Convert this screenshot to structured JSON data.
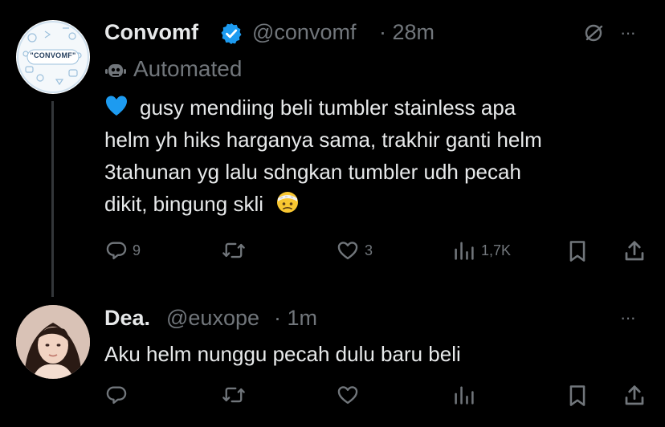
{
  "tweet1": {
    "display_name": "Convomf",
    "handle": "@convomf",
    "time": "· 28m",
    "automated_label": "Automated",
    "avatar_text": "\"CONVOMF\"",
    "lines": [
      "gusy mendiing beli tumbler stainless apa",
      "helm yh hiks harganya sama, trakhir ganti helm",
      "3tahunan yg lalu sdngkan tumbler udh pecah",
      "dikit, bingung skli"
    ],
    "replies": "9",
    "reposts": "",
    "likes": "3",
    "views": "1,7K",
    "more": "···"
  },
  "tweet2": {
    "display_name": "Dea.",
    "handle": "@euxope",
    "time": "· 1m",
    "text": "Aku helm nunggu pecah dulu baru beli",
    "more": "···"
  },
  "colors": {
    "background": "#000000",
    "text": "#e7e9ea",
    "muted": "#71767b",
    "verified": "#1d9bf0",
    "heart_emoji": "#1d9bf0"
  },
  "icons": [
    "verified-icon",
    "grok-icon",
    "robot-icon",
    "heart-emoji-icon",
    "bandage-face-emoji-icon",
    "reply-icon",
    "repost-icon",
    "like-icon",
    "views-icon",
    "bookmark-icon",
    "share-icon",
    "more-icon"
  ]
}
